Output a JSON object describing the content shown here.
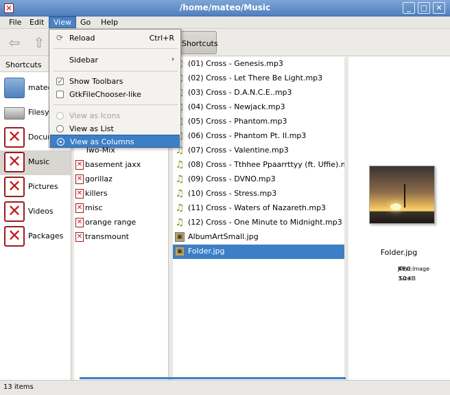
{
  "window": {
    "title": "/home/mateo/Music"
  },
  "menubar": {
    "file": "File",
    "edit": "Edit",
    "view": "View",
    "go": "Go",
    "help": "Help"
  },
  "toolbar": {
    "shortcuts_label": "Shortcuts"
  },
  "view_menu": {
    "reload": "Reload",
    "reload_accel": "Ctrl+R",
    "sidebar": "Sidebar",
    "show_toolbars": "Show Toolbars",
    "gtk_chooser": "GtkFileChooser-like",
    "view_icons": "View as Icons",
    "view_list": "View as List",
    "view_columns": "View as Columns"
  },
  "sidebar": {
    "header": "Shortcuts",
    "items": [
      {
        "label": "mateo",
        "icon": "home-folder-icon"
      },
      {
        "label": "Filesys",
        "icon": "drive-icon"
      },
      {
        "label": "Docum",
        "icon": "missing-icon"
      },
      {
        "label": "Music",
        "icon": "missing-icon"
      },
      {
        "label": "Pictures",
        "icon": "missing-icon"
      },
      {
        "label": "Videos",
        "icon": "missing-icon"
      },
      {
        "label": "Packages",
        "icon": "missing-icon"
      }
    ]
  },
  "column1": {
    "items": [
      "Two-Mix",
      "basement jaxx",
      "gorillaz",
      "killers",
      "misc",
      "orange range",
      "transmount"
    ]
  },
  "column2": {
    "items": [
      "(01) Cross - Genesis.mp3",
      "(02) Cross - Let There Be Light.mp3",
      "(03) Cross - D.A.N.C.E..mp3",
      "(04) Cross - Newjack.mp3",
      "(05) Cross - Phantom.mp3",
      "(06) Cross - Phantom Pt. II.mp3",
      "(07) Cross - Valentine.mp3",
      "(08) Cross - Tthhee Ppaarrttyy (ft. Uffie).mp3",
      "(09) Cross - DVNO.mp3",
      "(10) Cross - Stress.mp3",
      "(11) Cross - Waters of Nazareth.mp3",
      "(12) Cross - One Minute to Midnight.mp3",
      "AlbumArtSmall.jpg",
      "Folder.jpg"
    ],
    "selected_index": 13
  },
  "preview": {
    "filename": "Folder.jpg",
    "kind_label": "Kind:",
    "kind_value": "JPEG Image",
    "size_label": "Size:",
    "size_value": "3.0 KB"
  },
  "statusbar": {
    "text": "13 items"
  },
  "colors": {
    "selection": "#3c7fc6",
    "titlebar": "#5f8ec9",
    "music_icon": "#6f8f1a",
    "missing_icon": "#c41a1a"
  }
}
